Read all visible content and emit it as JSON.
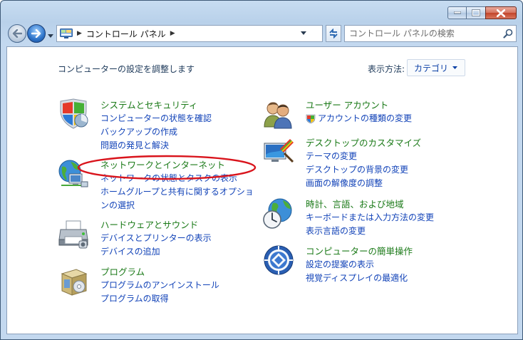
{
  "window": {
    "caption_buttons": [
      "minimize",
      "maximize",
      "close"
    ]
  },
  "navbar": {
    "address_path": "コントロール パネル",
    "search_placeholder": "コントロール パネルの検索"
  },
  "header": {
    "title": "コンピューターの設定を調整します",
    "view_by_label": "表示方法:",
    "view_by_value": "カテゴリ"
  },
  "left_categories": [
    {
      "icon": "security-shield-icon",
      "title": "システムとセキュリティ",
      "links": [
        "コンピューターの状態を確認",
        "バックアップの作成",
        "問題の発見と解決"
      ]
    },
    {
      "icon": "network-globe-icon",
      "title": "ネットワークとインターネット",
      "links": [
        "ネットワークの状態とタスクの表示",
        "ホームグループと共有に関するオプショ",
        "ンの選択"
      ]
    },
    {
      "icon": "printer-icon",
      "title": "ハードウェアとサウンド",
      "links": [
        "デバイスとプリンターの表示",
        "デバイスの追加"
      ]
    },
    {
      "icon": "programs-box-icon",
      "title": "プログラム",
      "links": [
        "プログラムのアンインストール",
        "プログラムの取得"
      ]
    }
  ],
  "right_categories": [
    {
      "icon": "user-accounts-icon",
      "title": "ユーザー アカウント",
      "links": [
        "アカウントの種類の変更"
      ]
    },
    {
      "icon": "desktop-appearance-icon",
      "title": "デスクトップのカスタマイズ",
      "links": [
        "テーマの変更",
        "デスクトップの背景の変更",
        "画面の解像度の調整"
      ]
    },
    {
      "icon": "clock-globe-icon",
      "title": "時計、言語、および地域",
      "links": [
        "キーボードまたは入力方法の変更",
        "表示言語の変更"
      ]
    },
    {
      "icon": "ease-of-access-icon",
      "title": "コンピューターの簡単操作",
      "links": [
        "設定の提案の表示",
        "視覚ディスプレイの最適化"
      ]
    }
  ],
  "colors": {
    "category_title": "#1b7a18",
    "link": "#1243b8",
    "highlight": "#d9141c"
  }
}
